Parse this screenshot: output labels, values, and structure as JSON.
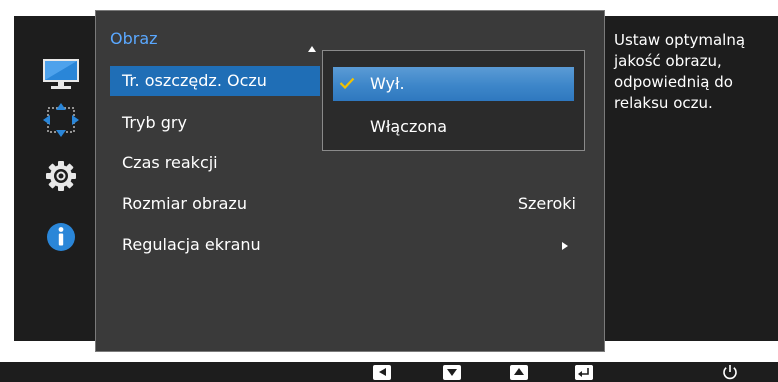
{
  "colors": {
    "accent_title": "#5aa8ff",
    "selection": "#1f6eb6",
    "check": "#f2c200",
    "panel": "#3a3a3a",
    "dark": "#1d1d1d"
  },
  "sidebar": {
    "categories": [
      {
        "icon": "monitor-picture-icon",
        "active": true
      },
      {
        "icon": "screen-adjust-arrows-icon",
        "active": false
      },
      {
        "icon": "gear-icon",
        "active": false
      },
      {
        "icon": "info-icon",
        "active": false
      }
    ]
  },
  "menu": {
    "title": "Obraz",
    "items": [
      {
        "label": "Tr. oszczędz. Oczu",
        "value": "",
        "selected": true
      },
      {
        "label": "Tryb gry",
        "value": ""
      },
      {
        "label": "Czas reakcji",
        "value": ""
      },
      {
        "label": "Rozmiar obrazu",
        "value": "Szeroki"
      },
      {
        "label": "Regulacja ekranu",
        "value": "",
        "submenu_arrow": true
      }
    ]
  },
  "dropdown": {
    "options": [
      {
        "label": "Wył.",
        "checked": true,
        "highlighted": true
      },
      {
        "label": "Włączona",
        "checked": false
      }
    ]
  },
  "help": {
    "text": "Ustaw optymalną jakość obrazu, odpowiednią do relaksu oczu."
  },
  "bottom_bar": {
    "buttons": [
      "left-arrow-icon",
      "down-arrow-icon",
      "up-arrow-icon",
      "enter-icon",
      "power-icon"
    ]
  }
}
